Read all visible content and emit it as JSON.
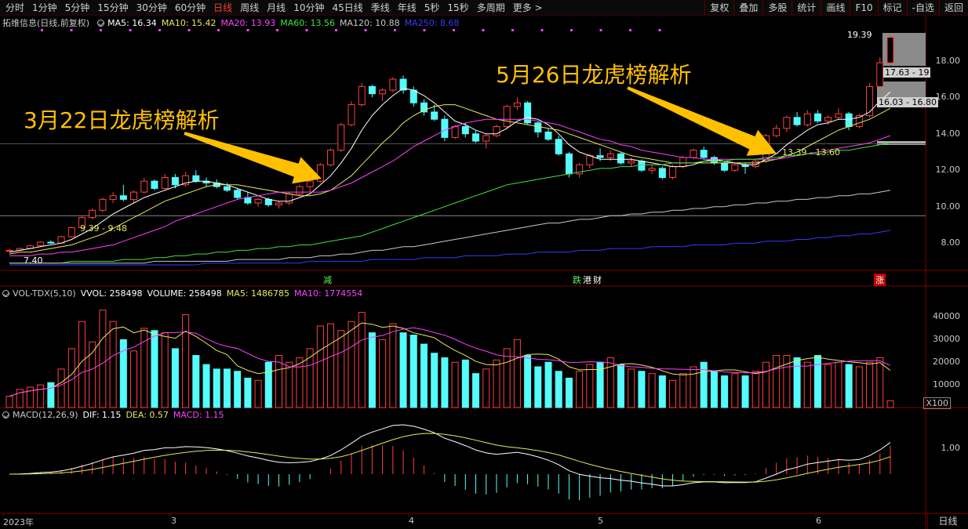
{
  "toolbar": {
    "tabs": [
      "分时",
      "1分钟",
      "5分钟",
      "15分钟",
      "30分钟",
      "60分钟",
      "日线",
      "周线",
      "月线",
      "10分钟",
      "45日线",
      "季线",
      "年线",
      "5秒",
      "15秒",
      "多周期",
      "更多 >"
    ],
    "active_tab": 6,
    "tools": [
      "复权",
      "叠加",
      "多股",
      "统计",
      "画线",
      "F10",
      "标记",
      "-自选",
      "返回"
    ]
  },
  "main_legend": {
    "stock": "拓维信息(日线,前复权)",
    "ma5": "MA5: 16.34",
    "ma10": "MA10: 15.42",
    "ma20": "MA20: 13.93",
    "ma60": "MA60: 13.56",
    "ma120": "MA120: 10.88",
    "ma250": "MA250: 8.68"
  },
  "vol_legend": {
    "name": "VOL-TDX(5,10)",
    "vvol": "VVOL: 258498",
    "volume": "VOLUME: 258498",
    "ma5": "MA5: 1486785",
    "ma10": "MA10: 1774554"
  },
  "macd_legend": {
    "name": "MACD(12,26,9)",
    "dif": "DIF: 1.15",
    "dea": "DEA: 0.57",
    "macd": "MACD: 1.15"
  },
  "annotations": {
    "left": "3月22日龙虎榜解析",
    "right": "5月26日龙虎榜解析"
  },
  "price_axis": [
    "18.00",
    "16.00",
    "14.00",
    "12.00",
    "10.00",
    "8.00"
  ],
  "vol_axis": [
    "40000",
    "30000",
    "20000",
    "10000"
  ],
  "vol_unit": "X100",
  "macd_axis": [
    "1.00"
  ],
  "x_axis": [
    "2023年",
    "3",
    "4",
    "5",
    "6"
  ],
  "price_labels": {
    "high": "19.39",
    "low_start": "7.40",
    "range1": "9.39 - 9.48",
    "range2": "13.39 - 13.60",
    "band1": "17.63 - 19",
    "band2": "16.03 - 16.80"
  },
  "event_tags": {
    "t1": "减",
    "t2": "跌",
    "t3": "港",
    "t4": "财",
    "t5": "涨"
  },
  "period_label": "日线",
  "colors": {
    "up": "#ff4040",
    "down": "#54fcfc",
    "ma5": "#ffffff",
    "ma10": "#e8e85a",
    "ma20": "#ff40ff",
    "ma60": "#40e040",
    "ma120": "#c8c8c8",
    "ma250": "#3838ff",
    "annotation": "#ffc000"
  },
  "chart_data": {
    "type": "candlestick",
    "candles": [
      [
        7.55,
        7.7,
        7.5,
        7.6
      ],
      [
        7.6,
        7.75,
        7.55,
        7.7
      ],
      [
        7.7,
        7.9,
        7.65,
        7.85
      ],
      [
        7.85,
        8.1,
        7.8,
        8.05
      ],
      [
        8.05,
        8.15,
        7.95,
        8.0
      ],
      [
        8.0,
        8.4,
        7.95,
        8.35
      ],
      [
        8.35,
        8.9,
        8.3,
        8.85
      ],
      [
        8.85,
        9.5,
        8.8,
        9.4
      ],
      [
        9.4,
        9.9,
        9.3,
        9.8
      ],
      [
        9.8,
        10.5,
        9.7,
        10.4
      ],
      [
        10.4,
        10.8,
        10.2,
        10.6
      ],
      [
        10.6,
        11.2,
        10.3,
        10.4
      ],
      [
        10.4,
        10.9,
        10.2,
        10.8
      ],
      [
        10.8,
        11.6,
        10.7,
        11.4
      ],
      [
        11.4,
        11.5,
        10.9,
        11.0
      ],
      [
        11.0,
        11.8,
        10.9,
        11.6
      ],
      [
        11.6,
        11.8,
        11.0,
        11.2
      ],
      [
        11.2,
        11.9,
        11.1,
        11.7
      ],
      [
        11.7,
        12.0,
        11.3,
        11.4
      ],
      [
        11.4,
        11.6,
        11.1,
        11.3
      ],
      [
        11.3,
        11.5,
        11.0,
        11.1
      ],
      [
        11.1,
        11.3,
        10.8,
        10.9
      ],
      [
        10.9,
        11.0,
        10.4,
        10.5
      ],
      [
        10.5,
        10.8,
        10.1,
        10.2
      ],
      [
        10.2,
        10.5,
        10.0,
        10.4
      ],
      [
        10.4,
        10.5,
        10.0,
        10.1
      ],
      [
        10.1,
        10.3,
        9.9,
        10.2
      ],
      [
        10.2,
        10.8,
        10.1,
        10.7
      ],
      [
        10.7,
        11.2,
        10.6,
        11.1
      ],
      [
        11.1,
        11.5,
        10.8,
        11.4
      ],
      [
        11.4,
        12.4,
        11.3,
        12.3
      ],
      [
        12.3,
        13.2,
        12.2,
        13.1
      ],
      [
        13.1,
        14.6,
        13.0,
        14.5
      ],
      [
        14.5,
        15.8,
        14.4,
        15.6
      ],
      [
        15.6,
        16.8,
        15.5,
        16.6
      ],
      [
        16.6,
        16.7,
        16.0,
        16.2
      ],
      [
        16.2,
        16.5,
        15.8,
        16.4
      ],
      [
        16.4,
        17.1,
        16.3,
        17.0
      ],
      [
        17.0,
        17.2,
        16.2,
        16.4
      ],
      [
        16.4,
        16.6,
        15.5,
        15.7
      ],
      [
        15.7,
        15.9,
        15.0,
        15.2
      ],
      [
        15.2,
        15.6,
        14.7,
        14.8
      ],
      [
        14.8,
        15.0,
        13.6,
        13.8
      ],
      [
        13.8,
        14.5,
        13.7,
        14.4
      ],
      [
        14.4,
        14.6,
        13.8,
        14.0
      ],
      [
        14.0,
        14.2,
        13.5,
        13.6
      ],
      [
        13.6,
        14.0,
        13.2,
        13.9
      ],
      [
        13.9,
        14.5,
        13.8,
        14.4
      ],
      [
        14.4,
        15.6,
        14.3,
        15.5
      ],
      [
        15.5,
        16.0,
        15.3,
        15.7
      ],
      [
        15.7,
        15.8,
        14.5,
        14.6
      ],
      [
        14.6,
        14.7,
        13.8,
        14.1
      ],
      [
        14.1,
        14.3,
        13.6,
        13.7
      ],
      [
        13.7,
        13.9,
        12.8,
        12.9
      ],
      [
        12.9,
        13.0,
        11.6,
        11.8
      ],
      [
        11.8,
        12.4,
        11.6,
        12.3
      ],
      [
        12.3,
        12.9,
        12.1,
        12.8
      ],
      [
        12.8,
        13.2,
        12.5,
        12.7
      ],
      [
        12.7,
        13.1,
        12.5,
        12.9
      ],
      [
        12.9,
        13.0,
        12.3,
        12.4
      ],
      [
        12.4,
        12.7,
        12.2,
        12.5
      ],
      [
        12.5,
        12.6,
        11.9,
        12.0
      ],
      [
        12.0,
        12.3,
        11.8,
        12.1
      ],
      [
        12.1,
        12.2,
        11.5,
        11.6
      ],
      [
        11.6,
        12.3,
        11.5,
        12.2
      ],
      [
        12.2,
        12.8,
        12.1,
        12.7
      ],
      [
        12.7,
        13.2,
        12.6,
        13.1
      ],
      [
        13.1,
        13.3,
        12.6,
        12.7
      ],
      [
        12.7,
        12.8,
        12.3,
        12.4
      ],
      [
        12.4,
        12.5,
        11.9,
        12.0
      ],
      [
        12.0,
        12.4,
        11.9,
        12.3
      ],
      [
        12.3,
        12.4,
        11.8,
        12.2
      ],
      [
        12.2,
        12.6,
        12.1,
        12.5
      ],
      [
        12.5,
        14.0,
        12.4,
        13.9
      ],
      [
        13.9,
        14.5,
        13.8,
        14.3
      ],
      [
        14.3,
        15.0,
        14.1,
        14.9
      ],
      [
        14.9,
        15.2,
        14.4,
        14.5
      ],
      [
        14.5,
        15.3,
        14.4,
        15.1
      ],
      [
        15.1,
        15.3,
        14.6,
        14.7
      ],
      [
        14.7,
        15.0,
        14.5,
        14.9
      ],
      [
        14.9,
        15.4,
        14.8,
        15.1
      ],
      [
        15.1,
        15.2,
        14.2,
        14.4
      ],
      [
        14.4,
        15.1,
        14.3,
        15.0
      ],
      [
        15.0,
        16.8,
        14.9,
        16.6
      ],
      [
        16.6,
        18.2,
        16.5,
        17.9
      ],
      [
        17.9,
        19.4,
        17.8,
        19.3
      ]
    ],
    "volume": [
      50,
      80,
      90,
      100,
      110,
      170,
      260,
      380,
      290,
      430,
      380,
      300,
      250,
      350,
      340,
      330,
      260,
      410,
      230,
      190,
      170,
      170,
      160,
      130,
      120,
      200,
      230,
      200,
      220,
      260,
      360,
      370,
      340,
      380,
      420,
      330,
      300,
      370,
      330,
      320,
      280,
      240,
      220,
      200,
      210,
      150,
      170,
      210,
      260,
      300,
      230,
      180,
      200,
      160,
      130,
      160,
      190,
      200,
      220,
      190,
      170,
      160,
      150,
      140,
      120,
      150,
      180,
      200,
      160,
      140,
      150,
      140,
      160,
      200,
      230,
      230,
      220,
      200,
      230,
      190,
      200,
      190,
      180,
      200,
      220,
      30
    ],
    "ma_lines": [
      {
        "name": "MA5",
        "values": [
          7.5,
          7.6,
          7.7,
          7.8,
          7.9,
          8.0,
          8.2,
          8.5,
          8.8,
          9.2,
          9.6,
          9.9,
          10.2,
          10.5,
          10.7,
          10.9,
          11.1,
          11.3,
          11.4,
          11.4,
          11.3,
          11.2,
          11.0,
          10.8,
          10.6,
          10.4,
          10.3,
          10.3,
          10.5,
          10.7,
          11.2,
          11.7,
          12.4,
          13.2,
          14.2,
          15.0,
          15.6,
          16.1,
          16.5,
          16.4,
          16.1,
          15.7,
          15.2,
          14.7,
          14.5,
          14.2,
          14.0,
          14.0,
          14.3,
          14.7,
          14.9,
          14.8,
          14.5,
          14.0,
          13.4,
          13.0,
          12.8,
          12.6,
          12.6,
          12.6,
          12.6,
          12.5,
          12.4,
          12.3,
          12.2,
          12.2,
          12.3,
          12.5,
          12.6,
          12.5,
          12.4,
          12.3,
          12.3,
          12.6,
          12.9,
          13.4,
          13.8,
          14.2,
          14.5,
          14.6,
          14.8,
          14.8,
          14.9,
          15.2,
          15.8,
          16.3
        ]
      },
      {
        "name": "MA10",
        "values": [
          7.4,
          7.5,
          7.5,
          7.6,
          7.7,
          7.8,
          7.9,
          8.1,
          8.3,
          8.5,
          8.8,
          9.1,
          9.4,
          9.7,
          10.0,
          10.3,
          10.5,
          10.7,
          10.9,
          11.1,
          11.2,
          11.2,
          11.2,
          11.1,
          11.0,
          10.9,
          10.8,
          10.7,
          10.6,
          10.6,
          10.7,
          10.9,
          11.3,
          11.7,
          12.3,
          12.9,
          13.5,
          14.0,
          14.6,
          15.0,
          15.3,
          15.5,
          15.6,
          15.6,
          15.4,
          15.2,
          15.0,
          14.8,
          14.7,
          14.6,
          14.5,
          14.4,
          14.3,
          14.2,
          14.0,
          13.8,
          13.6,
          13.4,
          13.2,
          13.0,
          12.8,
          12.7,
          12.6,
          12.5,
          12.4,
          12.4,
          12.4,
          12.4,
          12.4,
          12.4,
          12.4,
          12.4,
          12.4,
          12.5,
          12.6,
          12.8,
          13.0,
          13.3,
          13.6,
          13.9,
          14.2,
          14.4,
          14.6,
          14.8,
          15.1,
          15.4
        ]
      },
      {
        "name": "MA20",
        "values": [
          7.3,
          7.3,
          7.3,
          7.4,
          7.4,
          7.5,
          7.5,
          7.6,
          7.7,
          7.8,
          7.9,
          8.1,
          8.3,
          8.5,
          8.7,
          8.9,
          9.2,
          9.4,
          9.6,
          9.8,
          10.0,
          10.2,
          10.4,
          10.5,
          10.6,
          10.7,
          10.8,
          10.8,
          10.8,
          10.8,
          10.8,
          10.9,
          11.1,
          11.3,
          11.6,
          11.9,
          12.2,
          12.5,
          12.9,
          13.3,
          13.6,
          13.9,
          14.2,
          14.4,
          14.6,
          14.7,
          14.8,
          14.8,
          14.8,
          14.8,
          14.8,
          14.7,
          14.6,
          14.5,
          14.3,
          14.1,
          13.9,
          13.7,
          13.6,
          13.4,
          13.3,
          13.1,
          13.0,
          12.9,
          12.8,
          12.7,
          12.7,
          12.6,
          12.6,
          12.6,
          12.6,
          12.6,
          12.6,
          12.6,
          12.6,
          12.7,
          12.8,
          12.9,
          13.0,
          13.1,
          13.2,
          13.3,
          13.4,
          13.5,
          13.7,
          13.9
        ]
      },
      {
        "name": "MA60",
        "values": [
          6.9,
          6.9,
          6.9,
          6.9,
          6.9,
          6.9,
          7.0,
          7.0,
          7.0,
          7.0,
          7.0,
          7.1,
          7.1,
          7.1,
          7.2,
          7.2,
          7.3,
          7.3,
          7.4,
          7.4,
          7.5,
          7.5,
          7.6,
          7.6,
          7.7,
          7.7,
          7.8,
          7.8,
          7.9,
          7.9,
          8.0,
          8.1,
          8.2,
          8.3,
          8.4,
          8.6,
          8.8,
          9.0,
          9.2,
          9.4,
          9.6,
          9.8,
          10.0,
          10.2,
          10.4,
          10.6,
          10.8,
          11.0,
          11.2,
          11.3,
          11.4,
          11.5,
          11.6,
          11.7,
          11.8,
          11.9,
          12.0,
          12.1,
          12.1,
          12.2,
          12.2,
          12.3,
          12.3,
          12.3,
          12.4,
          12.4,
          12.4,
          12.5,
          12.5,
          12.5,
          12.6,
          12.6,
          12.6,
          12.7,
          12.7,
          12.8,
          12.8,
          12.9,
          12.9,
          13.0,
          13.1,
          13.1,
          13.2,
          13.3,
          13.4,
          13.5
        ]
      },
      {
        "name": "MA120",
        "values": [
          6.9,
          6.9,
          6.9,
          6.9,
          6.9,
          6.9,
          6.9,
          6.9,
          6.9,
          6.9,
          6.9,
          6.9,
          6.9,
          6.9,
          7.0,
          7.0,
          7.0,
          7.0,
          7.0,
          7.0,
          7.0,
          7.0,
          7.1,
          7.1,
          7.1,
          7.1,
          7.1,
          7.2,
          7.2,
          7.2,
          7.3,
          7.3,
          7.4,
          7.4,
          7.5,
          7.6,
          7.6,
          7.7,
          7.8,
          7.8,
          7.9,
          8.0,
          8.1,
          8.2,
          8.3,
          8.4,
          8.5,
          8.6,
          8.7,
          8.8,
          8.9,
          9.0,
          9.1,
          9.1,
          9.2,
          9.3,
          9.3,
          9.4,
          9.5,
          9.5,
          9.6,
          9.6,
          9.7,
          9.7,
          9.8,
          9.8,
          9.9,
          9.9,
          10.0,
          10.0,
          10.1,
          10.1,
          10.2,
          10.2,
          10.3,
          10.3,
          10.4,
          10.4,
          10.5,
          10.5,
          10.6,
          10.6,
          10.7,
          10.7,
          10.8,
          10.9
        ]
      },
      {
        "name": "MA250",
        "values": [
          6.8,
          6.8,
          6.8,
          6.8,
          6.8,
          6.8,
          6.8,
          6.8,
          6.8,
          6.8,
          6.8,
          6.8,
          6.8,
          6.8,
          6.8,
          6.8,
          6.8,
          6.8,
          6.8,
          6.9,
          6.9,
          6.9,
          6.9,
          6.9,
          6.9,
          6.9,
          6.9,
          6.9,
          6.9,
          7.0,
          7.0,
          7.0,
          7.0,
          7.0,
          7.0,
          7.1,
          7.1,
          7.1,
          7.1,
          7.1,
          7.2,
          7.2,
          7.2,
          7.2,
          7.3,
          7.3,
          7.3,
          7.3,
          7.4,
          7.4,
          7.4,
          7.5,
          7.5,
          7.5,
          7.5,
          7.6,
          7.6,
          7.6,
          7.7,
          7.7,
          7.7,
          7.7,
          7.8,
          7.8,
          7.8,
          7.8,
          7.9,
          7.9,
          7.9,
          7.9,
          8.0,
          8.0,
          8.0,
          8.1,
          8.1,
          8.1,
          8.2,
          8.2,
          8.3,
          8.3,
          8.4,
          8.4,
          8.5,
          8.5,
          8.6,
          8.7
        ]
      }
    ],
    "price_range": [
      6.5,
      19.8
    ],
    "vol_range": [
      0,
      450
    ]
  }
}
